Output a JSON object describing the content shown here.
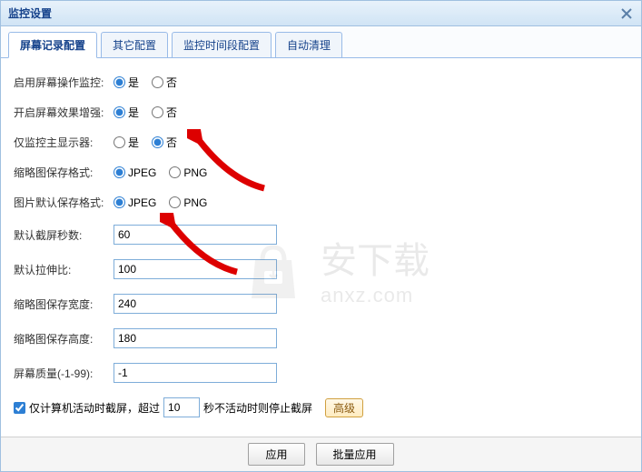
{
  "window": {
    "title": "监控设置"
  },
  "tabs": [
    {
      "label": "屏幕记录配置",
      "active": true
    },
    {
      "label": "其它配置",
      "active": false
    },
    {
      "label": "监控时间段配置",
      "active": false
    },
    {
      "label": "自动清理",
      "active": false
    }
  ],
  "radios": {
    "yes": "是",
    "no": "否",
    "jpeg": "JPEG",
    "png": "PNG"
  },
  "form": {
    "enable_monitor": {
      "label": "启用屏幕操作监控:",
      "value": "yes"
    },
    "enhance_effect": {
      "label": "开启屏幕效果增强:",
      "value": "yes"
    },
    "main_display_only": {
      "label": "仅监控主显示器:",
      "value": "no"
    },
    "thumb_format": {
      "label": "缩略图保存格式:",
      "value": "jpeg"
    },
    "default_format": {
      "label": "图片默认保存格式:",
      "value": "jpeg"
    },
    "default_seconds": {
      "label": "默认截屏秒数:",
      "value": "60"
    },
    "default_stretch": {
      "label": "默认拉伸比:",
      "value": "100"
    },
    "thumb_width": {
      "label": "缩略图保存宽度:",
      "value": "240"
    },
    "thumb_height": {
      "label": "缩略图保存高度:",
      "value": "180"
    },
    "screen_quality": {
      "label": "屏幕质量(-1-99):",
      "value": "-1"
    },
    "activity_checkbox": {
      "checked": true,
      "prefix": "仅计算机活动时截屏，超过",
      "seconds": "10",
      "suffix": "秒不活动时则停止截屏"
    },
    "advanced": "高级"
  },
  "footer": {
    "apply": "应用",
    "batch_apply": "批量应用"
  },
  "watermark": {
    "cn": "安下载",
    "en": "anxz.com"
  }
}
